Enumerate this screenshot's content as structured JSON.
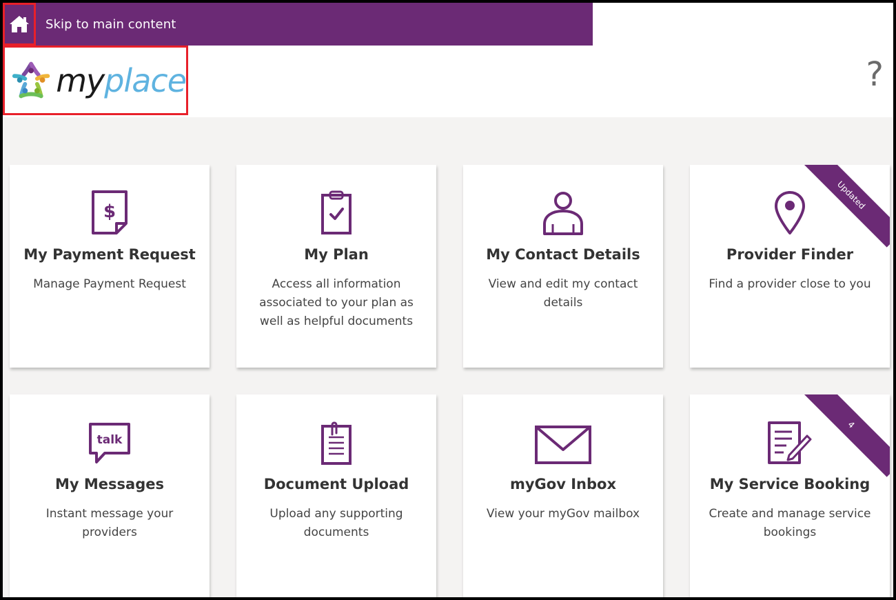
{
  "colors": {
    "brand_purple": "#6b2a75",
    "highlight_red": "#e8202a",
    "background": "#f4f3f2"
  },
  "header": {
    "home_icon": "home-icon",
    "skip_link": "Skip to main content",
    "logo": {
      "my": "my",
      "place": "place"
    },
    "help": "?"
  },
  "tiles": [
    {
      "title": "My Payment Request",
      "desc": "Manage Payment Request",
      "icon": "payment-document-icon"
    },
    {
      "title": "My Plan",
      "desc": "Access all information associated to your plan as well as helpful documents",
      "icon": "clipboard-check-icon"
    },
    {
      "title": "My Contact Details",
      "desc": "View and edit my contact details",
      "icon": "person-icon"
    },
    {
      "title": "Provider Finder",
      "desc": "Find a provider close to you",
      "icon": "map-pin-icon",
      "badge": "Updated"
    },
    {
      "title": "My Messages",
      "desc": "Instant message your providers",
      "icon": "talk-bubble-icon",
      "icon_text": "talk"
    },
    {
      "title": "Document Upload",
      "desc": "Upload any supporting documents",
      "icon": "paperclip-document-icon"
    },
    {
      "title": "myGov Inbox",
      "desc": "View your myGov mailbox",
      "icon": "envelope-icon"
    },
    {
      "title": "My Service Booking",
      "desc": "Create and manage service bookings",
      "icon": "document-edit-icon",
      "badge": "4"
    }
  ]
}
